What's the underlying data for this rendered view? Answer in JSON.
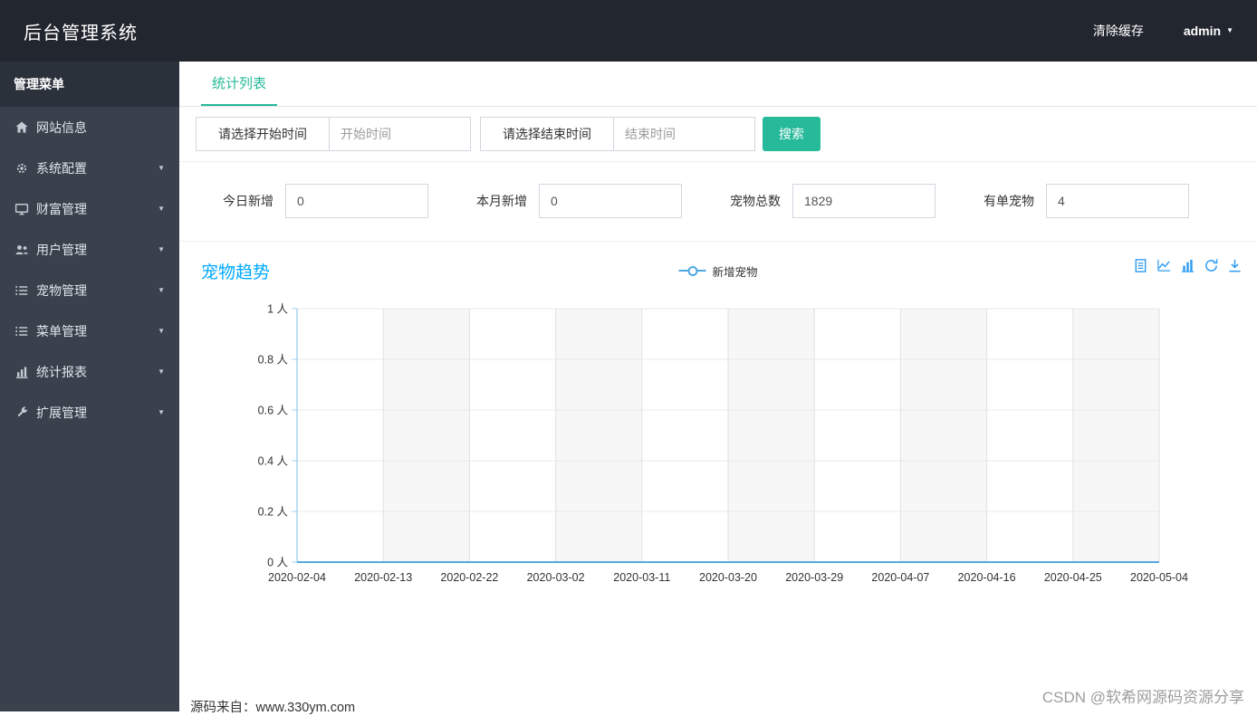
{
  "topbar": {
    "title": "后台管理系统",
    "clear_cache_label": "清除缓存",
    "user_label": "admin"
  },
  "sidebar": {
    "header": "管理菜单",
    "items": [
      {
        "label": "网站信息",
        "icon": "home-icon",
        "expandable": false
      },
      {
        "label": "系统配置",
        "icon": "gears-icon",
        "expandable": true
      },
      {
        "label": "财富管理",
        "icon": "display-icon",
        "expandable": true
      },
      {
        "label": "用户管理",
        "icon": "users-icon",
        "expandable": true
      },
      {
        "label": "宠物管理",
        "icon": "list-icon",
        "expandable": true
      },
      {
        "label": "菜单管理",
        "icon": "list-icon",
        "expandable": true
      },
      {
        "label": "统计报表",
        "icon": "bar-chart-icon",
        "expandable": true
      },
      {
        "label": "扩展管理",
        "icon": "wrench-icon",
        "expandable": true
      }
    ]
  },
  "tabs": {
    "active_label": "统计列表"
  },
  "filter": {
    "start_button_label": "请选择开始时间",
    "start_placeholder": "开始时间",
    "end_button_label": "请选择结束时间",
    "end_placeholder": "结束时间",
    "search_button_label": "搜索"
  },
  "stats": [
    {
      "label": "今日新增",
      "value": "0"
    },
    {
      "label": "本月新增",
      "value": "0"
    },
    {
      "label": "宠物总数",
      "value": "1829"
    },
    {
      "label": "有单宠物",
      "value": "4"
    }
  ],
  "chart_section": {
    "title": "宠物趋势",
    "legend_label": "新增宠物",
    "toolbox_icons": [
      "data-view-icon",
      "line-chart-type-icon",
      "bar-chart-type-icon",
      "refresh-icon",
      "download-icon"
    ]
  },
  "chart_data": {
    "type": "line",
    "title": "宠物趋势",
    "x": [
      "2020-02-04",
      "2020-02-13",
      "2020-02-22",
      "2020-03-02",
      "2020-03-11",
      "2020-03-20",
      "2020-03-29",
      "2020-04-07",
      "2020-04-16",
      "2020-04-25",
      "2020-05-04"
    ],
    "series": [
      {
        "name": "新增宠物",
        "values": [
          0,
          0,
          0,
          0,
          0,
          0,
          0,
          0,
          0,
          0,
          0
        ]
      }
    ],
    "ylim": [
      0,
      1
    ],
    "yticks": [
      0,
      0.2,
      0.4,
      0.6,
      0.8,
      1
    ],
    "y_unit": "人",
    "grid": true,
    "legend_position": "top-center"
  },
  "footer": {
    "source_text": "源码来自：www.330ym.com"
  },
  "watermark": "CSDN @软希网源码资源分享",
  "colors": {
    "accent_teal": "#26b99a",
    "chart_title_blue": "#00aaff",
    "series_blue": "#54a8e0",
    "axis_blue": "#a9d3ee",
    "toolbox_blue": "#2f9df4",
    "topbar_bg": "#22262f",
    "sidebar_bg": "#39414d"
  }
}
